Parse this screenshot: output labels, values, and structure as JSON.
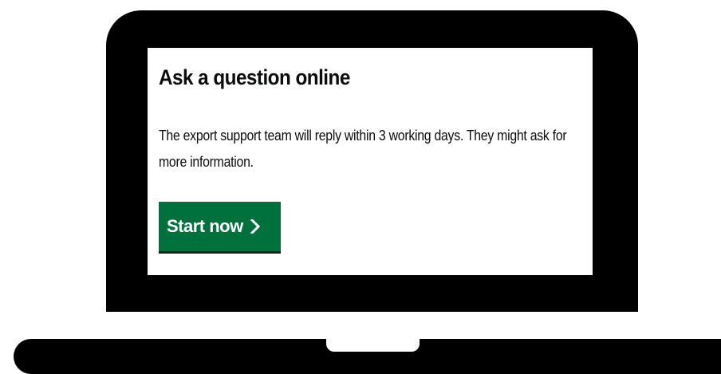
{
  "content": {
    "title": "Ask a question online",
    "description": "The export support team will reply within 3 working days. They might ask for more information.",
    "start_button": {
      "label": "Start now",
      "icon": "chevron-right-icon",
      "color": "#00703c"
    }
  },
  "colors": {
    "device": "#000000",
    "screen_background": "#ffffff",
    "text": "#0b0c0c"
  }
}
